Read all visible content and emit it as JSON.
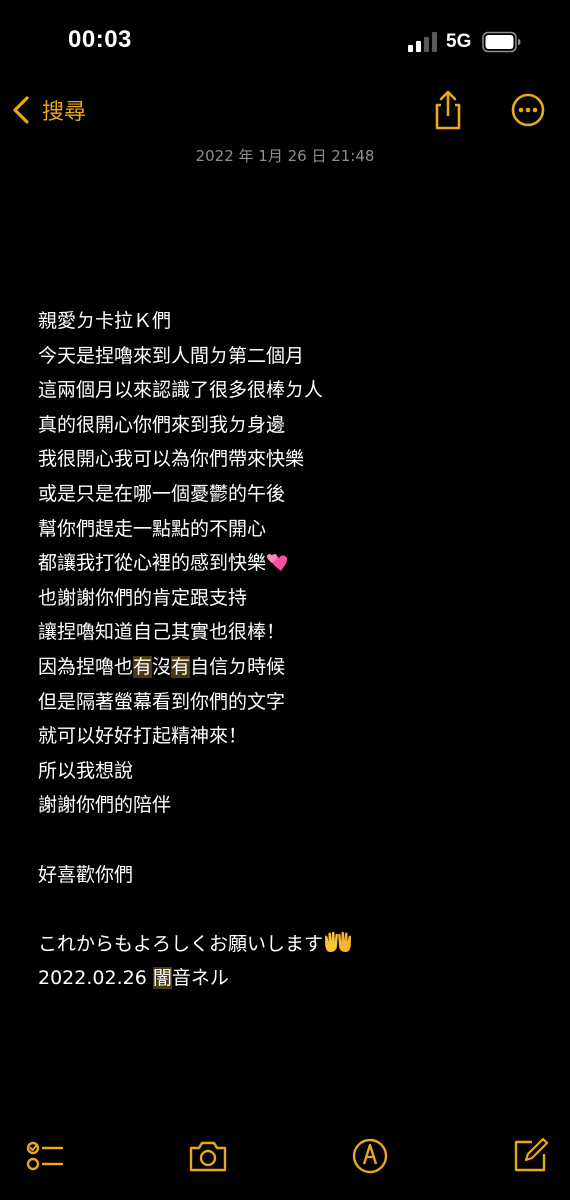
{
  "status_bar": {
    "time": "00:03",
    "network": "5G",
    "signal_icon": "cellular-signal-icon",
    "battery_icon": "battery-icon"
  },
  "nav": {
    "back_label": "搜尋",
    "back_icon": "chevron-left-icon",
    "share_icon": "share-icon",
    "more_icon": "more-circle-icon"
  },
  "note": {
    "date": "2022 年 1月 26 日 21:48",
    "lines": {
      "l1": "親愛ㄉ卡拉Ｋ們",
      "l2": "今天是捏嚕來到人間ㄉ第二個月",
      "l3": "這兩個月以來認識了很多很棒ㄉ人",
      "l4": "真的很開心你們來到我ㄉ身邊",
      "l5": "我很開心我可以為你們帶來快樂",
      "l6": "或是只是在哪一個憂鬱的午後",
      "l7": "幫你們趕走一點點的不開心",
      "l8": "都讓我打從心裡的感到快樂",
      "l9": "也謝謝你們的肯定跟支持",
      "l10": "讓捏嚕知道自己其實也很棒！",
      "l11a": "因為捏嚕也",
      "l11b": "有",
      "l11c": "沒",
      "l11d": "有",
      "l11e": "自信ㄉ時候",
      "l12": "但是隔著螢幕看到你們的文字",
      "l13": "就可以好好打起精神來！",
      "l14": "所以我想說",
      "l15": "謝謝你們的陪伴",
      "l17": "好喜歡你們",
      "l19": "これからもよろしくお願いします",
      "l20a": "2022.02.26 ",
      "l20b": "闇",
      "l20c": "音ネル"
    },
    "emoji": {
      "heart": "two-hearts-emoji",
      "hands": "palms-up-hands-emoji"
    }
  },
  "toolbar": {
    "checklist_icon": "checklist-icon",
    "camera_icon": "camera-icon",
    "markup_icon": "markup-pen-icon",
    "compose_icon": "compose-icon"
  },
  "colors": {
    "accent": "#e6a91b",
    "background": "#000000",
    "text": "#ffffff",
    "secondary_text": "#8e8e93",
    "highlight": "#4a3a10"
  }
}
